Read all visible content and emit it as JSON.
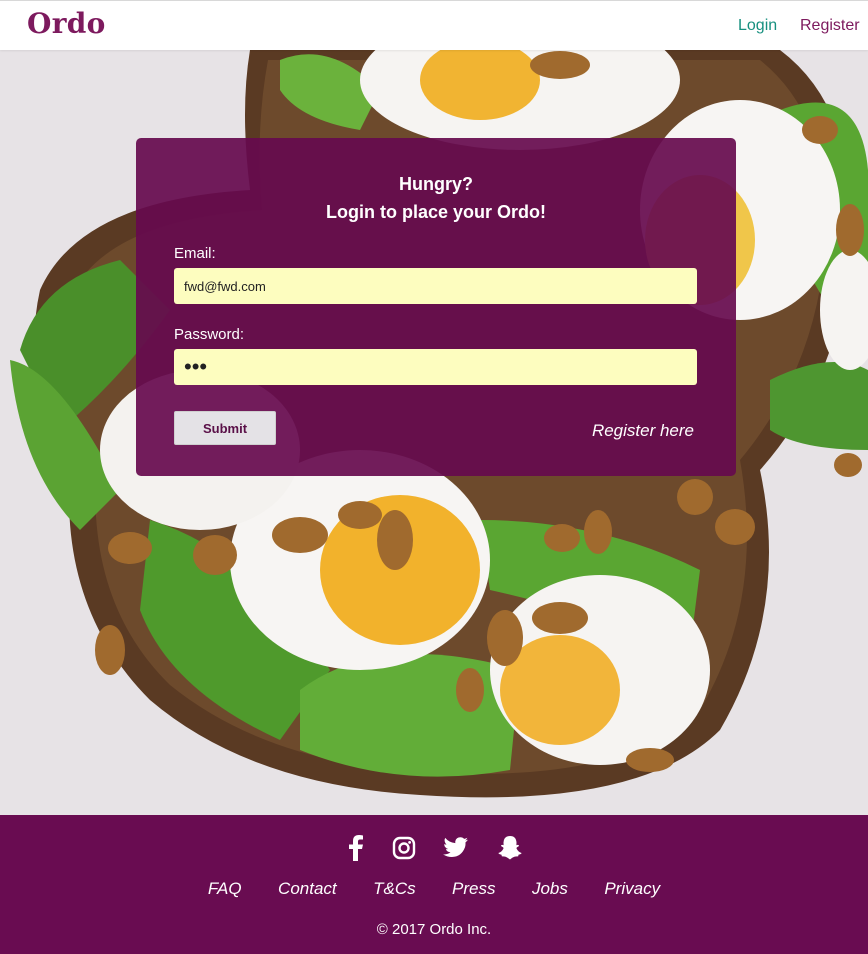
{
  "header": {
    "logo": "Ordo",
    "nav": {
      "login": "Login",
      "register": "Register"
    }
  },
  "login_card": {
    "heading_line1": "Hungry?",
    "heading_line2": "Login to place your Ordo!",
    "email_label": "Email:",
    "email_value": "fwd@fwd.com",
    "password_label": "Password:",
    "password_mask": "•••",
    "submit_label": "Submit",
    "register_link": "Register here"
  },
  "footer": {
    "social_icons": [
      "facebook-icon",
      "instagram-icon",
      "twitter-icon",
      "snapchat-icon"
    ],
    "links": [
      "FAQ",
      "Contact",
      "T&Cs",
      "Press",
      "Jobs",
      "Privacy"
    ],
    "copyright": "© 2017 Ordo Inc."
  },
  "colors": {
    "brand_purple": "#690c51",
    "login_teal": "#17907f",
    "input_yellow": "#fdfdbf"
  }
}
